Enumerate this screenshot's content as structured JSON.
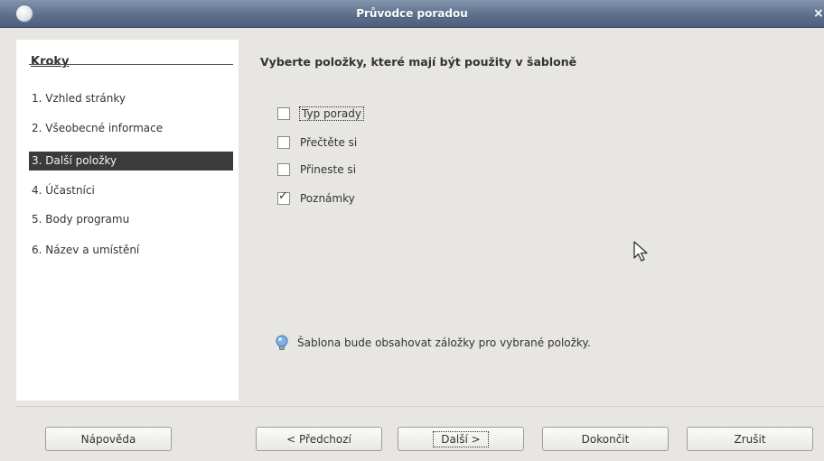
{
  "window": {
    "title": "Průvodce poradou"
  },
  "steps": {
    "title": "Kroky",
    "items": [
      {
        "label": "1. Vzhled stránky"
      },
      {
        "label": "2. Všeobecné informace"
      },
      {
        "label": "3. Další položky",
        "active": true
      },
      {
        "label": "4. Účastníci"
      },
      {
        "label": "5. Body programu"
      },
      {
        "label": "6. Název a umístění"
      }
    ]
  },
  "main": {
    "heading": "Vyberte položky, které mají být použity v šabloně",
    "options": [
      {
        "label": "Typ porady",
        "checked": false
      },
      {
        "label": "Přečtěte si",
        "checked": false
      },
      {
        "label": "Přineste si",
        "checked": false
      },
      {
        "label": "Poznámky",
        "checked": true
      }
    ],
    "info": "Šablona bude obsahovat záložky pro vybrané položky."
  },
  "buttons": {
    "help": "Nápověda",
    "back": "< Předchozí",
    "next": "Další >",
    "finish": "Dokončit",
    "cancel": "Zrušit"
  },
  "icons": {
    "window": "app-icon",
    "close": "close-icon",
    "info": "lightbulb-icon",
    "cursor": "mouse-pointer-icon"
  }
}
